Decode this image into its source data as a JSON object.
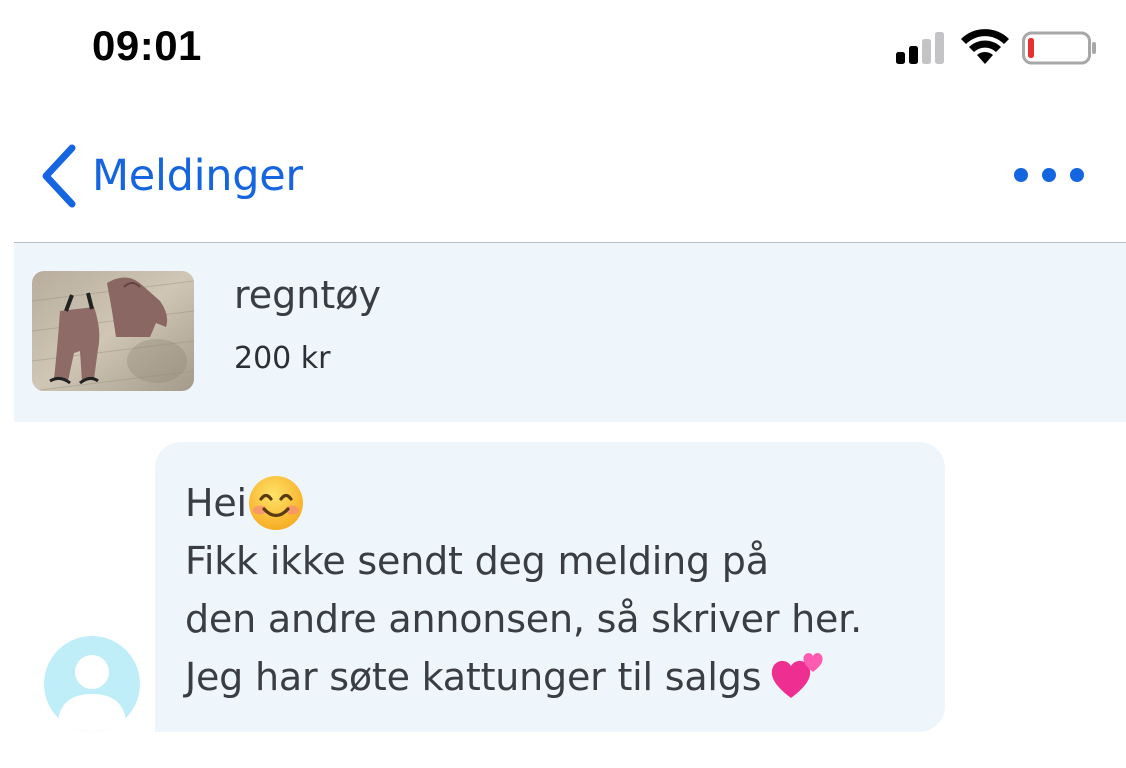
{
  "status_bar": {
    "time": "09:01",
    "icons": [
      "signal-icon",
      "wifi-icon",
      "battery-low-icon"
    ],
    "battery_color": "#e8312d"
  },
  "nav": {
    "back_label": "Meldinger",
    "back_icon": "chevron-left-icon",
    "more_icon": "more-dots-icon",
    "accent": "#1665e0"
  },
  "listing": {
    "title": "regntøy",
    "price": "200 kr",
    "background": "#eef6fc"
  },
  "message": {
    "lines": [
      "Hei",
      "Fikk ikke sendt deg melding på",
      "den andre annonsen, så skriver her.",
      "Jeg har søte kattunger til salgs"
    ],
    "emojis": [
      "smiling-face-icon",
      "two-hearts-icon"
    ],
    "avatar_icon": "default-avatar-icon"
  }
}
